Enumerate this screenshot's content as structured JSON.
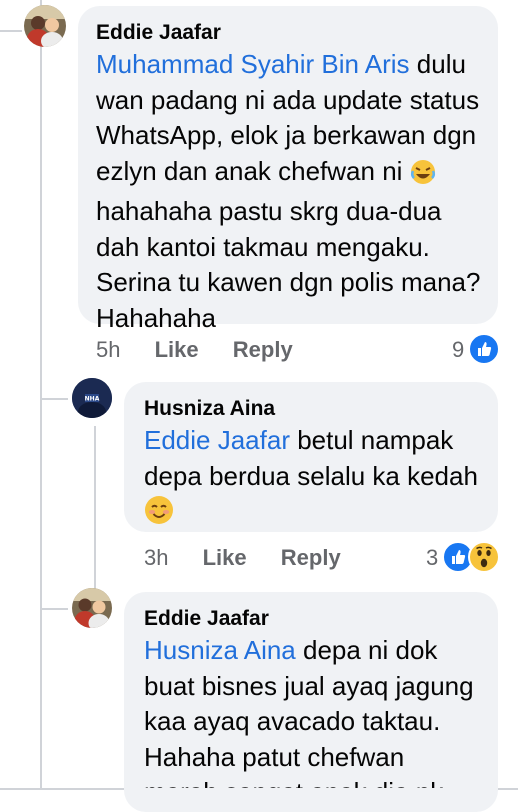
{
  "comments": [
    {
      "author": "Eddie Jaafar",
      "mention": "Muhammad Syahir Bin Aris",
      "lines": [
        " dulu",
        "wan padang ni ada update status",
        "WhatsApp, elok ja berkawan dgn",
        "ezlyn dan anak chefwan ni",
        "hahahaha pastu skrg dua-dua",
        "dah kantoi takmau mengaku.",
        "Serina tu kawen dgn polis mana?",
        "Hahahaha"
      ],
      "emoji": "rofl-emoji",
      "time": "5h",
      "like_label": "Like",
      "reply_label": "Reply",
      "reaction_count": "9",
      "reactions": [
        "like-icon"
      ]
    },
    {
      "author": "Husniza Aina",
      "avatar_text": "NHA",
      "mention": "Eddie Jaafar",
      "lines": [
        " betul nampak",
        "depa berdua selalu ka kedah"
      ],
      "emoji": "blush-emoji",
      "time": "3h",
      "like_label": "Like",
      "reply_label": "Reply",
      "reaction_count": "3",
      "reactions": [
        "like-icon",
        "wow-icon"
      ]
    },
    {
      "author": "Eddie Jaafar",
      "mention": "Husniza Aina",
      "lines": [
        " depa ni dok",
        "buat bisnes jual ayaq jagung",
        "kaa ayaq avacado taktau.",
        "Hahaha patut chefwan",
        "marah sangat anak dia nk"
      ]
    }
  ],
  "colors": {
    "bubble": "#f0f2f5",
    "mention": "#216fdb",
    "meta": "#65676b",
    "like_blue": "#1877f2"
  }
}
